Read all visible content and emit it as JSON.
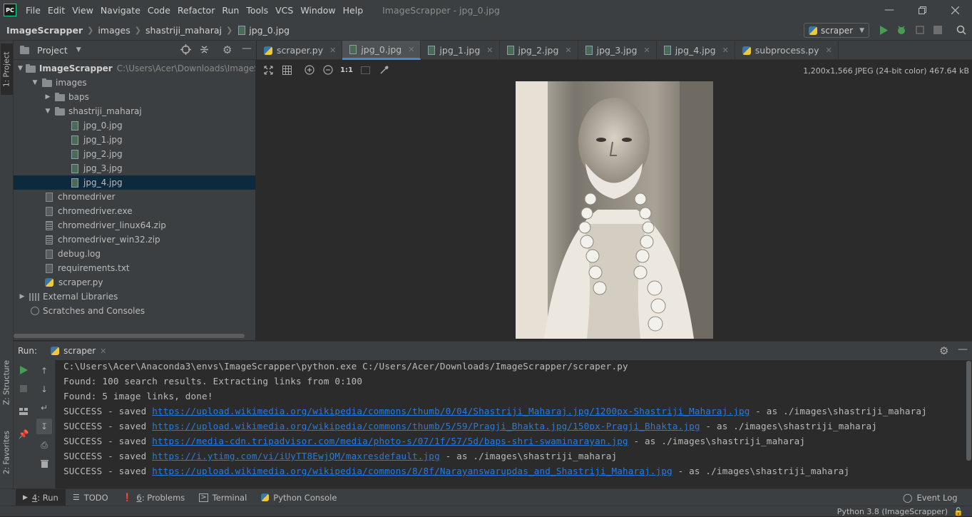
{
  "app": {
    "logo_text": "PC",
    "window_title": "ImageScrapper - jpg_0.jpg"
  },
  "menu": [
    "File",
    "Edit",
    "View",
    "Navigate",
    "Code",
    "Refactor",
    "Run",
    "Tools",
    "VCS",
    "Window",
    "Help"
  ],
  "breadcrumb": [
    "ImageScrapper",
    "images",
    "shastriji_maharaj",
    "jpg_0.jpg"
  ],
  "run_config": {
    "name": "scraper"
  },
  "left_stripe": {
    "project_tab": "1: Project",
    "structure_tab": "Z: Structure",
    "favorites_tab": "2: Favorites"
  },
  "project_panel": {
    "title": "Project"
  },
  "tree": [
    {
      "label": "ImageScrapper",
      "path": "C:\\Users\\Acer\\Downloads\\ImageScrapp",
      "kind": "folder",
      "depth": 0,
      "expanded": true
    },
    {
      "label": "images",
      "kind": "folder",
      "depth": 1,
      "expanded": true
    },
    {
      "label": "baps",
      "kind": "folder",
      "depth": 2,
      "expanded": false
    },
    {
      "label": "shastriji_maharaj",
      "kind": "folder",
      "depth": 2,
      "expanded": true
    },
    {
      "label": "jpg_0.jpg",
      "kind": "image",
      "depth": 3
    },
    {
      "label": "jpg_1.jpg",
      "kind": "image",
      "depth": 3
    },
    {
      "label": "jpg_2.jpg",
      "kind": "image",
      "depth": 3
    },
    {
      "label": "jpg_3.jpg",
      "kind": "image",
      "depth": 3
    },
    {
      "label": "jpg_4.jpg",
      "kind": "image",
      "depth": 3,
      "selected": true
    },
    {
      "label": "chromedriver",
      "kind": "file",
      "depth": 1
    },
    {
      "label": "chromedriver.exe",
      "kind": "file",
      "depth": 1
    },
    {
      "label": "chromedriver_linux64.zip",
      "kind": "zip",
      "depth": 1
    },
    {
      "label": "chromedriver_win32.zip",
      "kind": "zip",
      "depth": 1
    },
    {
      "label": "debug.log",
      "kind": "file",
      "depth": 1
    },
    {
      "label": "requirements.txt",
      "kind": "file",
      "depth": 1
    },
    {
      "label": "scraper.py",
      "kind": "python",
      "depth": 1
    },
    {
      "label": "External Libraries",
      "kind": "library",
      "depth": 0,
      "expanded": false
    },
    {
      "label": "Scratches and Consoles",
      "kind": "scratch",
      "depth": 0
    }
  ],
  "editor_tabs": [
    {
      "label": "scraper.py",
      "kind": "python",
      "active": false
    },
    {
      "label": "jpg_0.jpg",
      "kind": "image",
      "active": true
    },
    {
      "label": "jpg_1.jpg",
      "kind": "image",
      "active": false
    },
    {
      "label": "jpg_2.jpg",
      "kind": "image",
      "active": false
    },
    {
      "label": "jpg_3.jpg",
      "kind": "image",
      "active": false
    },
    {
      "label": "jpg_4.jpg",
      "kind": "image",
      "active": false
    },
    {
      "label": "subprocess.py",
      "kind": "python",
      "active": false
    }
  ],
  "image_viewer": {
    "actual_size_label": "1:1",
    "info": "1,200x1,566 JPEG (24-bit color) 467.64 kB"
  },
  "run_panel": {
    "title": "Run:",
    "tab": "scraper"
  },
  "console": [
    {
      "text": "C:\\Users\\Acer\\Anaconda3\\envs\\ImageScrapper\\python.exe C:/Users/Acer/Downloads/ImageScrapper/scraper.py"
    },
    {
      "text": "Found: 100 search results. Extracting links from 0:100"
    },
    {
      "text": "Found: 5 image links, done!"
    },
    {
      "prefix": "SUCCESS - saved ",
      "link": "https://upload.wikimedia.org/wikipedia/commons/thumb/0/04/Shastriji_Maharaj.jpg/1200px-Shastriji_Maharaj.jpg",
      "suffix": " - as ./images\\shastriji_maharaj"
    },
    {
      "prefix": "SUCCESS - saved ",
      "link": "https://upload.wikimedia.org/wikipedia/commons/thumb/5/59/Pragji_Bhakta.jpg/150px-Pragji_Bhakta.jpg",
      "suffix": " - as ./images\\shastriji_maharaj"
    },
    {
      "prefix": "SUCCESS - saved ",
      "link": "https://media-cdn.tripadvisor.com/media/photo-s/07/1f/57/5d/baps-shri-swaminarayan.jpg",
      "suffix": " - as ./images\\shastriji_maharaj"
    },
    {
      "prefix": "SUCCESS - saved ",
      "link": "https://i.ytimg.com/vi/iUyTT8EwjQM/maxresdefault.jpg",
      "suffix": " - as ./images\\shastriji_maharaj"
    },
    {
      "prefix": "SUCCESS - saved ",
      "link": "https://upload.wikimedia.org/wikipedia/commons/8/8f/Narayanswarupdas_and_Shastriji_Maharaj.jpg",
      "suffix": " - as ./images\\shastriji_maharaj"
    }
  ],
  "tool_windows": [
    {
      "mnemonic": "4",
      "label": ": Run",
      "icon": "play-icon",
      "active": true
    },
    {
      "mnemonic": "",
      "label": "TODO",
      "icon": "list-icon",
      "active": false
    },
    {
      "mnemonic": "6",
      "label": ": Problems",
      "icon": "warning-icon",
      "active": false
    },
    {
      "mnemonic": "",
      "label": "Terminal",
      "icon": "terminal-icon",
      "active": false
    },
    {
      "mnemonic": "",
      "label": "Python Console",
      "icon": "python-icon",
      "active": false
    }
  ],
  "event_log": "Event Log",
  "status": {
    "interpreter": "Python 3.8 (ImageScrapper)"
  },
  "colors": {
    "accent": "#4a88c7",
    "run_green": "#499c54",
    "link": "#287bde",
    "selection": "#0d293e"
  }
}
